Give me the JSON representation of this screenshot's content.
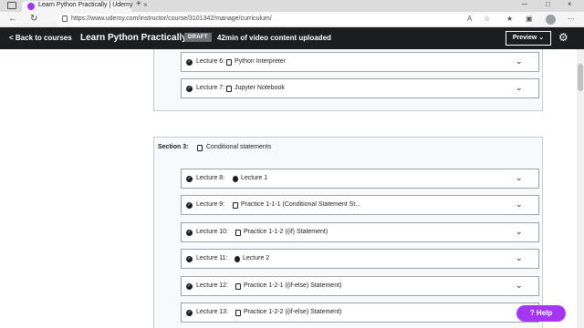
{
  "browser": {
    "tab_title": "Learn Python Practically | Udemy",
    "tab_close": "×",
    "new_tab": "+",
    "url": "https://www.udemy.com/instructor/course/3101342/manage/curriculum/",
    "win_min": "─",
    "win_max": "□",
    "win_close": "×"
  },
  "header": {
    "back_label": "<  Back to courses",
    "course_title": "Learn Python Practically",
    "status_badge": "DRAFT",
    "upload_status": "42min of video content uploaded",
    "preview_label": "Preview  ⌄",
    "settings_icon": "gear-icon"
  },
  "sections": [
    {
      "lectures": [
        {
          "number": "Lecture 6:",
          "type": "article",
          "title": "Python Interpreter"
        },
        {
          "number": "Lecture 7:",
          "type": "article",
          "title": "Jupyter Notebook"
        }
      ]
    },
    {
      "label": "Section 3:",
      "title": "Conditional statements",
      "lectures": [
        {
          "number": "Lecture 8:",
          "type": "video",
          "title": "Lecture 1"
        },
        {
          "number": "Lecture 9:",
          "type": "article",
          "title": "Practice 1-1-1 (Conditional Statement St..."
        },
        {
          "number": "Lecture 10:",
          "type": "article",
          "title": "Practice 1-1-2 ((if) Statement)"
        },
        {
          "number": "Lecture 11:",
          "type": "video",
          "title": "Lecture 2"
        },
        {
          "number": "Lecture 12:",
          "type": "article",
          "title": "Practice 1-2-1 ((if-else) Statement)"
        },
        {
          "number": "Lecture 13:",
          "type": "article",
          "title": "Practice 1-2-2 ((if-else) Statement)"
        }
      ]
    }
  ],
  "help_label": "? Help",
  "colors": {
    "header_bg": "#1c1d1f",
    "accent": "#a435f0",
    "section_bg": "#f7f9fa"
  }
}
